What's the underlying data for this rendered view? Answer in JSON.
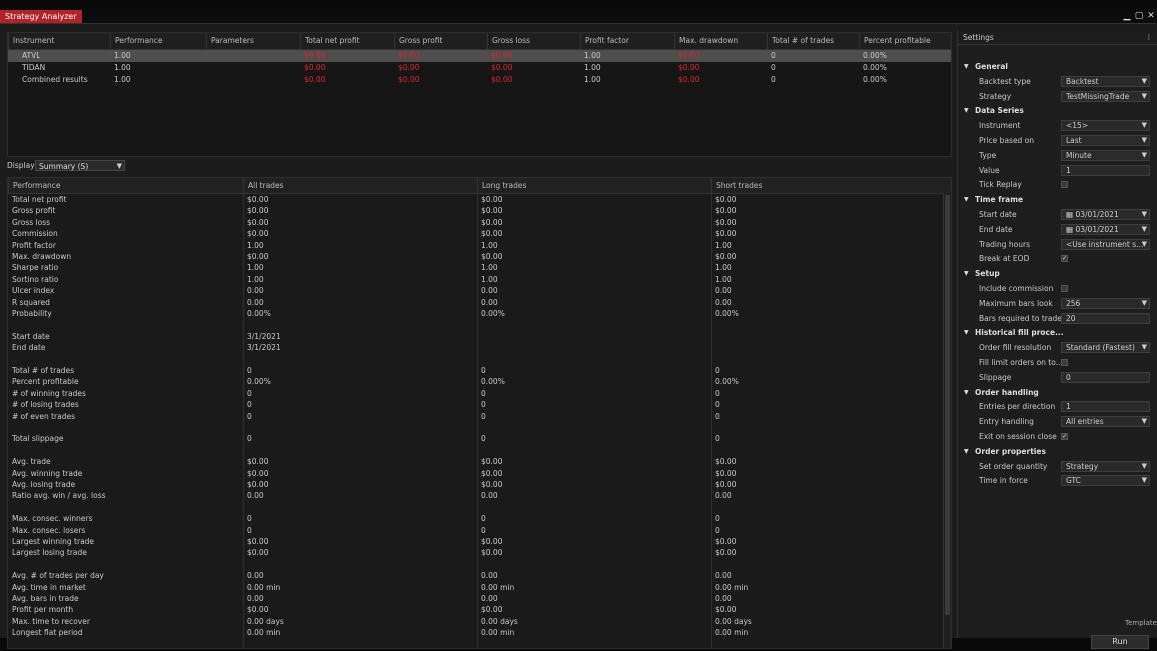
{
  "window": {
    "title": "Strategy Analyzer",
    "buttons": [
      "▁",
      "▢",
      "✕"
    ]
  },
  "results_table": {
    "columns": [
      "Instrument",
      "Performance",
      "Parameters",
      "Total net profit",
      "Gross profit",
      "Gross loss",
      "Profit factor",
      "Max. drawdown",
      "Total # of trades",
      "Percent profitable"
    ],
    "rows": [
      {
        "cells": [
          "ATVL",
          "1.00",
          "",
          "$0.00",
          "$0.00",
          "$0.00",
          "1.00",
          "$0.00",
          "0",
          "0.00%"
        ],
        "selected": true
      },
      {
        "cells": [
          "TIDAN",
          "1.00",
          "",
          "$0.00",
          "$0.00",
          "$0.00",
          "1.00",
          "$0.00",
          "0",
          "0.00%"
        ],
        "selected": false
      },
      {
        "cells": [
          "Combined results",
          "1.00",
          "",
          "$0.00",
          "$0.00",
          "$0.00",
          "1.00",
          "$0.00",
          "0",
          "0.00%"
        ],
        "selected": false
      }
    ]
  },
  "display": {
    "label": "Display",
    "value": "Summary (S)"
  },
  "perf_table": {
    "columns": [
      "Performance",
      "All trades",
      "Long trades",
      "Short trades"
    ],
    "rows": [
      [
        "Total net profit",
        "$0.00",
        "$0.00",
        "$0.00"
      ],
      [
        "Gross profit",
        "$0.00",
        "$0.00",
        "$0.00"
      ],
      [
        "Gross loss",
        "$0.00",
        "$0.00",
        "$0.00"
      ],
      [
        "Commission",
        "$0.00",
        "$0.00",
        "$0.00"
      ],
      [
        "Profit factor",
        "1.00",
        "1.00",
        "1.00"
      ],
      [
        "Max. drawdown",
        "$0.00",
        "$0.00",
        "$0.00"
      ],
      [
        "Sharpe ratio",
        "1.00",
        "1.00",
        "1.00"
      ],
      [
        "Sortino ratio",
        "1.00",
        "1.00",
        "1.00"
      ],
      [
        "Ulcer index",
        "0.00",
        "0.00",
        "0.00"
      ],
      [
        "R squared",
        "0.00",
        "0.00",
        "0.00"
      ],
      [
        "Probability",
        "0.00%",
        "0.00%",
        "0.00%"
      ],
      [
        "",
        "",
        "",
        ""
      ],
      [
        "Start date",
        "3/1/2021",
        "",
        ""
      ],
      [
        "End date",
        "3/1/2021",
        "",
        ""
      ],
      [
        "",
        "",
        "",
        ""
      ],
      [
        "Total # of trades",
        "0",
        "0",
        "0"
      ],
      [
        "Percent profitable",
        "0.00%",
        "0.00%",
        "0.00%"
      ],
      [
        "# of winning trades",
        "0",
        "0",
        "0"
      ],
      [
        "# of losing trades",
        "0",
        "0",
        "0"
      ],
      [
        "# of even trades",
        "0",
        "0",
        "0"
      ],
      [
        "",
        "",
        "",
        ""
      ],
      [
        "Total slippage",
        "0",
        "0",
        "0"
      ],
      [
        "",
        "",
        "",
        ""
      ],
      [
        "Avg. trade",
        "$0.00",
        "$0.00",
        "$0.00"
      ],
      [
        "Avg. winning trade",
        "$0.00",
        "$0.00",
        "$0.00"
      ],
      [
        "Avg. losing trade",
        "$0.00",
        "$0.00",
        "$0.00"
      ],
      [
        "Ratio avg. win / avg. loss",
        "0.00",
        "0.00",
        "0.00"
      ],
      [
        "",
        "",
        "",
        ""
      ],
      [
        "Max. consec. winners",
        "0",
        "0",
        "0"
      ],
      [
        "Max. consec. losers",
        "0",
        "0",
        "0"
      ],
      [
        "Largest winning trade",
        "$0.00",
        "$0.00",
        "$0.00"
      ],
      [
        "Largest losing trade",
        "$0.00",
        "$0.00",
        "$0.00"
      ],
      [
        "",
        "",
        "",
        ""
      ],
      [
        "Avg. # of trades per day",
        "0.00",
        "0.00",
        "0.00"
      ],
      [
        "Avg. time in market",
        "0.00 min",
        "0.00 min",
        "0.00 min"
      ],
      [
        "Avg. bars in trade",
        "0.00",
        "0.00",
        "0.00"
      ],
      [
        "Profit per month",
        "$0.00",
        "$0.00",
        "$0.00"
      ],
      [
        "Max. time to recover",
        "0.00 days",
        "0.00 days",
        "0.00 days"
      ],
      [
        "Longest flat period",
        "0.00 min",
        "0.00 min",
        "0.00 min"
      ]
    ]
  },
  "properties": {
    "title": "Settings",
    "menu_icon": "⁝",
    "lines": [
      {
        "type": "cat",
        "label": "General"
      },
      {
        "type": "select",
        "label": "Backtest type",
        "value": "Backtest"
      },
      {
        "type": "select",
        "label": "Strategy",
        "value": "TestMissingTrade"
      },
      {
        "type": "cat",
        "label": "Data Series"
      },
      {
        "type": "select",
        "label": "Instrument",
        "value": "<15>"
      },
      {
        "type": "select",
        "label": "Price based on",
        "value": "Last"
      },
      {
        "type": "select",
        "label": "Type",
        "value": "Minute"
      },
      {
        "type": "text",
        "label": "Value",
        "value": "1"
      },
      {
        "type": "check",
        "label": "Tick Replay",
        "checked": false
      },
      {
        "type": "cat",
        "label": "Time frame"
      },
      {
        "type": "date",
        "label": "Start date",
        "value": "03/01/2021"
      },
      {
        "type": "date",
        "label": "End date",
        "value": "03/01/2021"
      },
      {
        "type": "select",
        "label": "Trading hours",
        "value": "<Use instrument s..."
      },
      {
        "type": "check",
        "label": "Break at EOD",
        "checked": true
      },
      {
        "type": "cat",
        "label": "Setup"
      },
      {
        "type": "check",
        "label": "Include commission",
        "checked": false
      },
      {
        "type": "select",
        "label": "Maximum bars look",
        "value": "256"
      },
      {
        "type": "text",
        "label": "Bars required to trade",
        "value": "20"
      },
      {
        "type": "cat",
        "label": "Historical fill proce..."
      },
      {
        "type": "select",
        "label": "Order fill resolution",
        "value": "Standard (Fastest)"
      },
      {
        "type": "check",
        "label": "Fill limit orders on to...",
        "checked": false
      },
      {
        "type": "text",
        "label": "Slippage",
        "value": "0"
      },
      {
        "type": "cat",
        "label": "Order handling"
      },
      {
        "type": "text",
        "label": "Entries per direction",
        "value": "1"
      },
      {
        "type": "select",
        "label": "Entry handling",
        "value": "All entries"
      },
      {
        "type": "check",
        "label": "Exit on session close",
        "checked": true
      },
      {
        "type": "cat",
        "label": "Order properties"
      },
      {
        "type": "select",
        "label": "Set order quantity",
        "value": "Strategy"
      },
      {
        "type": "select",
        "label": "Time in force",
        "value": "GTC"
      }
    ]
  },
  "template_label": "Template",
  "run_label": "Run"
}
